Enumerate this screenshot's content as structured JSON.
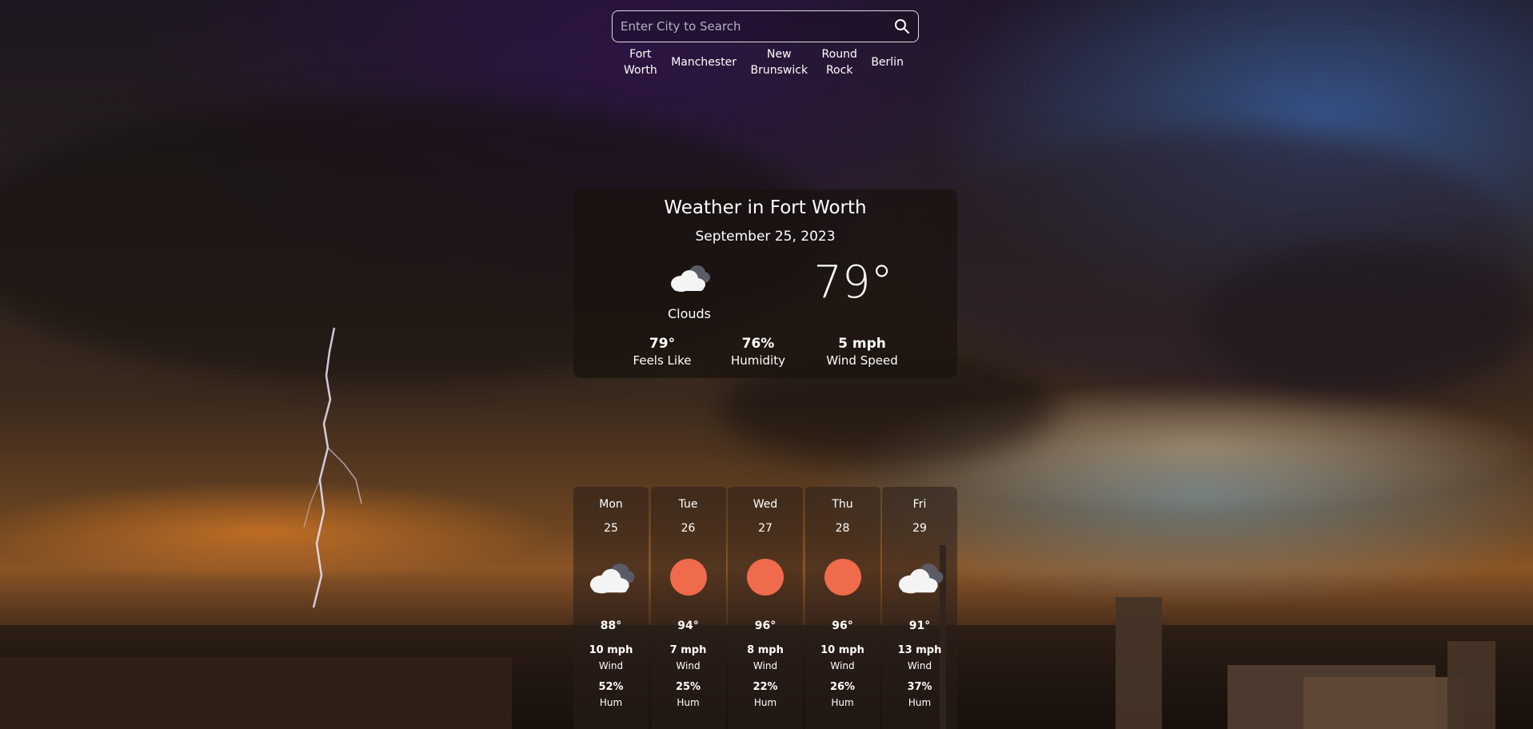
{
  "search": {
    "placeholder": "Enter City to Search",
    "button_icon": "search-icon"
  },
  "quick_cities": [
    {
      "label": "Fort\nWorth"
    },
    {
      "label": "Manchester"
    },
    {
      "label": "New\nBrunswick"
    },
    {
      "label": "Round\nRock"
    },
    {
      "label": "Berlin"
    }
  ],
  "current": {
    "title": "Weather in Fort Worth",
    "date": "September 25, 2023",
    "icon": "clouds-icon",
    "condition": "Clouds",
    "temperature": "79°",
    "feels_like": {
      "value": "79°",
      "label": "Feels Like"
    },
    "humidity": {
      "value": "76%",
      "label": "Humidity"
    },
    "wind_speed": {
      "value": "5 mph",
      "label": "Wind Speed"
    }
  },
  "forecast": [
    {
      "day": "Mon",
      "date": "25",
      "icon": "clouds-icon",
      "temp": "88°",
      "wind": "10 mph",
      "wind_label": "Wind",
      "humidity": "52%",
      "humidity_label": "Hum"
    },
    {
      "day": "Tue",
      "date": "26",
      "icon": "sun-icon",
      "temp": "94°",
      "wind": "7 mph",
      "wind_label": "Wind",
      "humidity": "25%",
      "humidity_label": "Hum"
    },
    {
      "day": "Wed",
      "date": "27",
      "icon": "sun-icon",
      "temp": "96°",
      "wind": "8 mph",
      "wind_label": "Wind",
      "humidity": "22%",
      "humidity_label": "Hum"
    },
    {
      "day": "Thu",
      "date": "28",
      "icon": "sun-icon",
      "temp": "96°",
      "wind": "10 mph",
      "wind_label": "Wind",
      "humidity": "26%",
      "humidity_label": "Hum"
    },
    {
      "day": "Fri",
      "date": "29",
      "icon": "clouds-icon",
      "temp": "91°",
      "wind": "13 mph",
      "wind_label": "Wind",
      "humidity": "37%",
      "humidity_label": "Hum"
    }
  ],
  "colors": {
    "sun": "#ef6b4b",
    "card_bg": "#19120e"
  }
}
